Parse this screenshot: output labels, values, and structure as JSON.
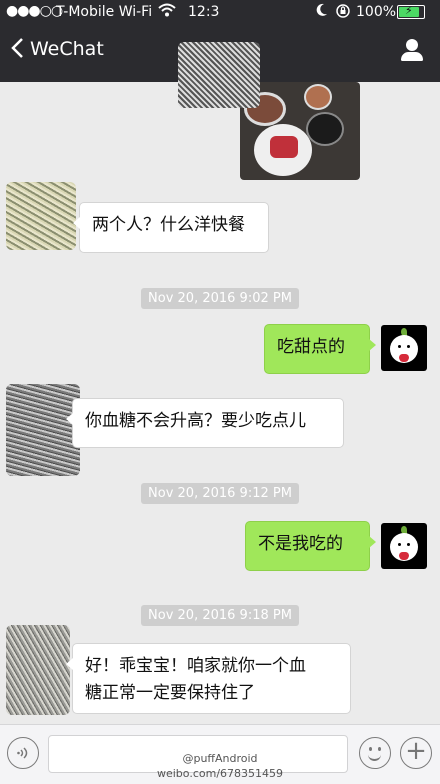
{
  "status_bar": {
    "signal": "●●●○○",
    "carrier": "T-Mobile Wi-Fi",
    "wifi_icon": "wifi-icon",
    "time": "12:3",
    "battery_percent": "100%"
  },
  "nav": {
    "back_label": "WeChat",
    "profile_icon": "person-icon"
  },
  "messages": [
    {
      "type": "image",
      "side": "out"
    },
    {
      "type": "text",
      "side": "in",
      "text": "两个人？什么洋快餐"
    },
    {
      "type": "time",
      "text": "Nov 20, 2016 9:02 PM"
    },
    {
      "type": "text",
      "side": "out",
      "text": "吃甜点的"
    },
    {
      "type": "text",
      "side": "in",
      "text": "你血糖不会升高？要少吃点儿"
    },
    {
      "type": "time",
      "text": "Nov 20, 2016 9:12 PM"
    },
    {
      "type": "text",
      "side": "out",
      "text": "不是我吃的"
    },
    {
      "type": "time",
      "text": "Nov 20, 2016 9:18 PM"
    },
    {
      "type": "text",
      "side": "in",
      "text_line1": "好！乖宝宝！咱家就你一个血",
      "text_line2": "糖正常一定要保持住了"
    }
  ],
  "input_bar": {
    "voice_icon": "voice-icon",
    "emoji_icon": "smiley-icon",
    "plus_icon": "plus-icon",
    "input_value": ""
  },
  "watermark": {
    "line1": "@puffAndroid",
    "line2": "weibo.com/678351459"
  },
  "colors": {
    "header": "#2b2b2f",
    "background": "#ebebeb",
    "bubble_out": "#a0e75a",
    "bubble_in": "#ffffff",
    "timestamp_bg": "#cecece"
  }
}
